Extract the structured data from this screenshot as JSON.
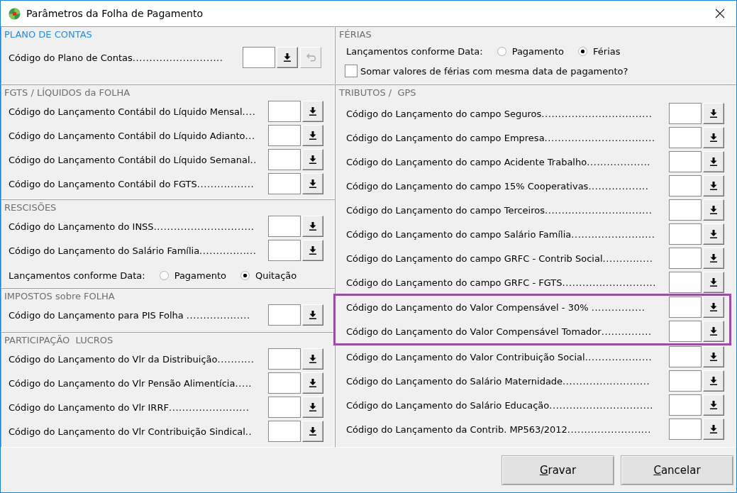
{
  "window": {
    "title": "Parâmetros da Folha de Pagamento"
  },
  "left_sections": [
    {
      "title": "PLANO DE CONTAS",
      "color": "#2b8ae0",
      "rows": [
        {
          "kind": "lookup",
          "label": "Código do Plano de Contas...........................",
          "undo_button": {
            "disabled": true
          }
        }
      ]
    },
    {
      "title": "FGTS / LÍQUIDOS da FOLHA",
      "color": "#6e6e6e",
      "rows": [
        {
          "kind": "lookup",
          "label": "Código do Lançamento Contábil do Líquido Mensal...."
        },
        {
          "kind": "lookup",
          "label": "Código do Lançamento Contábil do Líquido Adianto..."
        },
        {
          "kind": "lookup",
          "label": "Código do Lançamento Contábil do Líquido Semanal.."
        },
        {
          "kind": "lookup",
          "label": "Código do Lançamento Contábil do FGTS................."
        }
      ]
    },
    {
      "title": "RESCISÕES",
      "color": "#6e6e6e",
      "rows": [
        {
          "kind": "lookup",
          "label": "Código do Lançamento do INSS.............................."
        },
        {
          "kind": "lookup",
          "label": "Código do Lançamento do Salário Família................."
        },
        {
          "kind": "radio",
          "label": "Lançamentos conforme Data:",
          "options": [
            {
              "label": "Pagamento",
              "selected": false
            },
            {
              "label": "Quitação",
              "selected": true
            }
          ]
        }
      ]
    },
    {
      "title": "IMPOSTOS sobre FOLHA",
      "color": "#6e6e6e",
      "rows": [
        {
          "kind": "lookup",
          "label": "Código do Lançamento para PIS Folha ..................."
        }
      ]
    },
    {
      "title": "PARTICIPAÇÃO  LUCROS",
      "color": "#6e6e6e",
      "rows": [
        {
          "kind": "lookup",
          "label": "Código do Lançamento do Vlr da Distribuição..........."
        },
        {
          "kind": "lookup",
          "label": "Código do Lançamento do Vlr Pensão Alimentícia....."
        },
        {
          "kind": "lookup",
          "label": "Código do Lançamento do Vlr IRRF........................"
        },
        {
          "kind": "lookup",
          "label": "Código do Lançamento do Vlr Contribuição Sindical.."
        }
      ]
    }
  ],
  "right_sections": [
    {
      "title": "FÉRIAS",
      "color": "#6e6e6e",
      "rows": [
        {
          "kind": "radio",
          "label": "Lançamentos conforme Data:",
          "options": [
            {
              "label": "Pagamento",
              "selected": false
            },
            {
              "label": "Férias",
              "selected": true
            }
          ]
        },
        {
          "kind": "checkbox",
          "label": "Somar valores de férias com mesma data de pagamento?",
          "checked": false
        }
      ]
    },
    {
      "title": "TRIBUTOS /  GPS",
      "color": "#6e6e6e",
      "rows": [
        {
          "kind": "lookup",
          "label": "Código do Lançamento do campo Seguros.................................",
          "highlighted": false
        },
        {
          "kind": "lookup",
          "label": "Código do Lançamento do campo Empresa.................................",
          "highlighted": false
        },
        {
          "kind": "lookup",
          "label": "Código do Lançamento do campo Acidente Trabalho...................",
          "highlighted": false
        },
        {
          "kind": "lookup",
          "label": "Código do Lançamento do campo 15% Cooperativas..................",
          "highlighted": false
        },
        {
          "kind": "lookup",
          "label": "Código do Lançamento do campo Terceiros................................",
          "highlighted": false
        },
        {
          "kind": "lookup",
          "label": "Código do Lançamento do campo Salário Família.........................",
          "highlighted": false
        },
        {
          "kind": "lookup",
          "label": "Código do Lançamento do campo GRFC - Contrib Social...............",
          "highlighted": false
        },
        {
          "kind": "lookup",
          "label": "Código do Lançamento do campo GRFC - FGTS............................",
          "highlighted": false
        },
        {
          "kind": "lookup",
          "label": "Código do Lançamento do Valor Compensável - 30% ................",
          "highlighted": true
        },
        {
          "kind": "lookup",
          "label": "Código do Lançamento do Valor Compensável Tomador...............",
          "highlighted": true
        },
        {
          "kind": "lookup",
          "label": "Código do Lançamento do Valor Contribuição Social....................",
          "highlighted": false
        },
        {
          "kind": "lookup",
          "label": "Código do Lançamento do Salário Maternidade..........................",
          "highlighted": false
        },
        {
          "kind": "lookup",
          "label": "Código do Lançamento do Salário Educação...............................",
          "highlighted": false
        },
        {
          "kind": "lookup",
          "label": "Código do Lançamento da Contrib. MP563/2012.........................",
          "highlighted": false
        }
      ]
    }
  ],
  "buttons": [
    {
      "label": "Gravar"
    },
    {
      "label": "Cancelar"
    }
  ]
}
